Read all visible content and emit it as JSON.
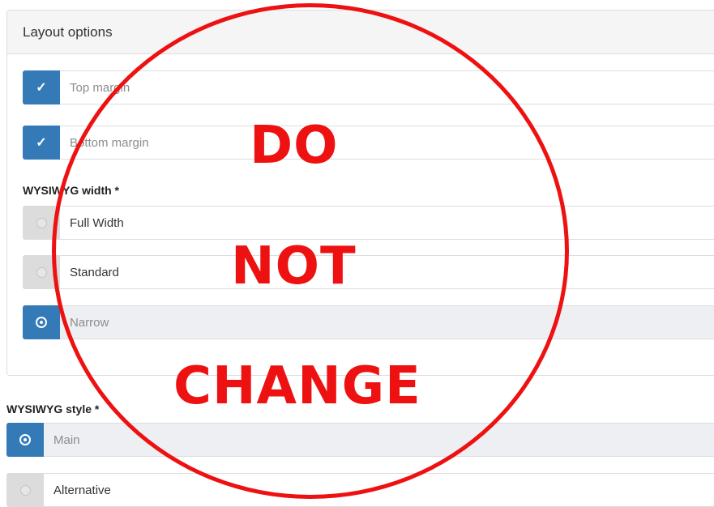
{
  "panel": {
    "title": "Layout options"
  },
  "margins": [
    {
      "label": "Top margin",
      "checked": true
    },
    {
      "label": "Bottom margin",
      "checked": true
    }
  ],
  "width_group": {
    "label": "WYSIWYG width *",
    "options": [
      {
        "label": "Full Width",
        "selected": false
      },
      {
        "label": "Standard",
        "selected": false
      },
      {
        "label": "Narrow",
        "selected": true
      }
    ]
  },
  "style_group": {
    "label": "WYSIWYG style *",
    "options": [
      {
        "label": "Main",
        "selected": true
      },
      {
        "label": "Alternative",
        "selected": false
      }
    ]
  },
  "stamp": {
    "line1": "DO",
    "line2": "NOT",
    "line3": "CHANGE",
    "color": "#ee1111"
  },
  "colors": {
    "accent": "#337ab7",
    "inactive": "#dcdcdc"
  }
}
